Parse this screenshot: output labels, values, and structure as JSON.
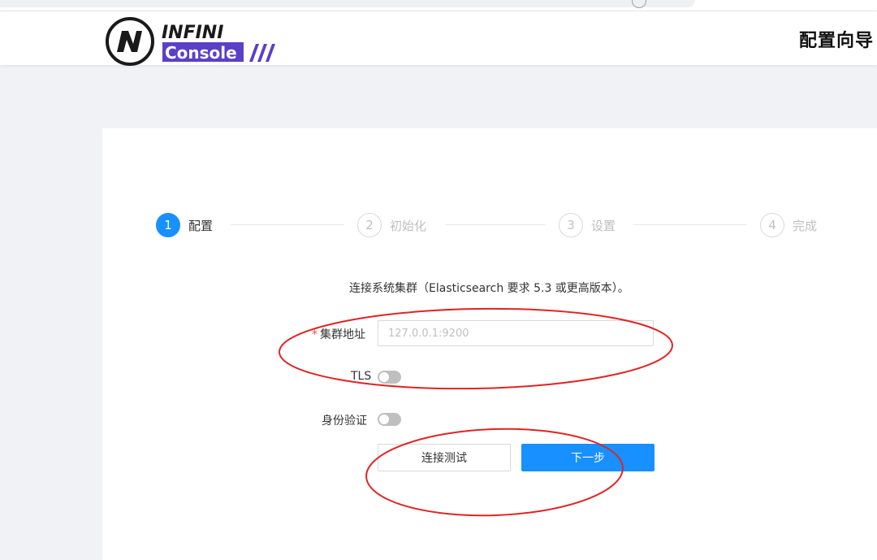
{
  "header": {
    "logo": {
      "line1": "INFINI",
      "line2": "Console"
    },
    "title": "配置向导"
  },
  "steps": [
    {
      "number": "1",
      "label": "配置",
      "status": "active"
    },
    {
      "number": "2",
      "label": "初始化",
      "status": "wait"
    },
    {
      "number": "3",
      "label": "设置",
      "status": "wait"
    },
    {
      "number": "4",
      "label": "完成",
      "status": "wait"
    }
  ],
  "form": {
    "intro": "连接系统集群（Elasticsearch 要求 5.3 或更高版本）。",
    "required_mark": "*",
    "cluster_label": "集群地址",
    "cluster_placeholder": "127.0.0.1:9200",
    "cluster_value": "",
    "tls_label": "TLS",
    "tls_enabled": false,
    "auth_label": "身份验证",
    "auth_enabled": false
  },
  "buttons": {
    "test_connection": "连接测试",
    "next": "下一步"
  },
  "colors": {
    "primary": "#1890ff",
    "annotation": "#e02424",
    "required": "#ff4d4f"
  }
}
